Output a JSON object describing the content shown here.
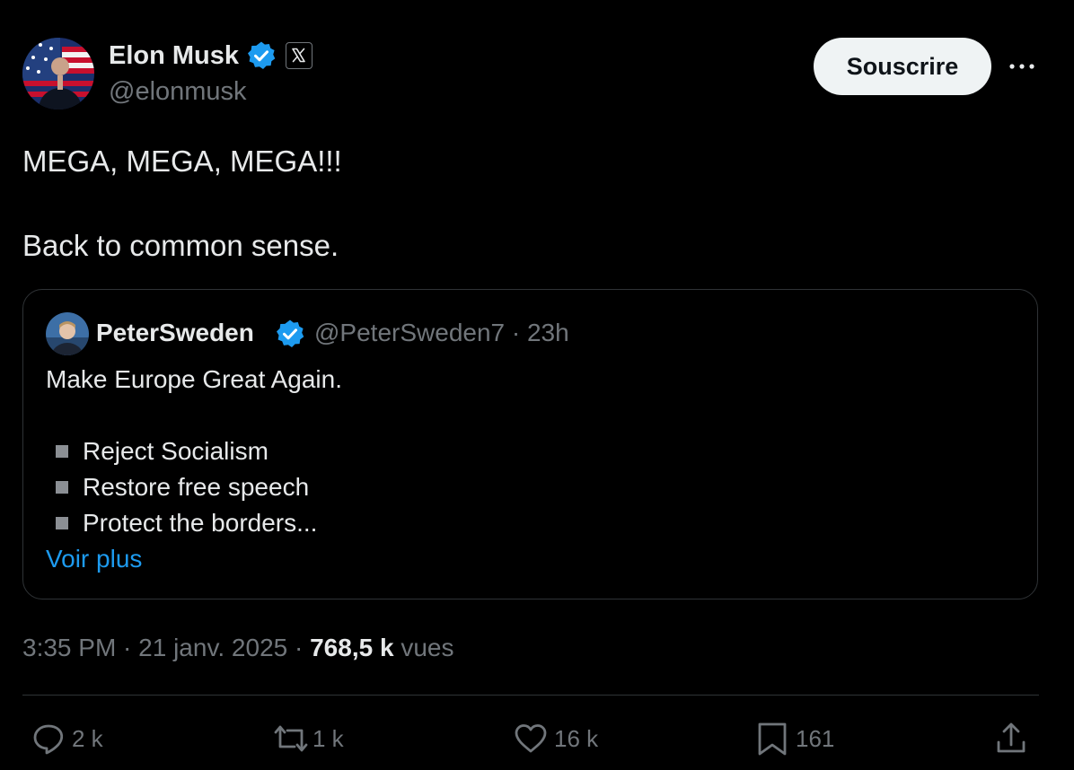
{
  "tweet": {
    "author": {
      "name": "Elon Musk",
      "handle": "@elonmusk",
      "avatar_icon": "avatar-photo-flag-background",
      "verified_icon": "verified-badge-icon",
      "affiliation_icon": "x-logo-icon"
    },
    "subscribe_label": "Souscrire",
    "more_icon": "more-dots-icon",
    "text_lines": [
      "MEGA, MEGA, MEGA!!!",
      "Back to common sense."
    ],
    "quote": {
      "name": "PeterSweden",
      "handle_time": "@PeterSweden7 · 23h",
      "text": "Make Europe Great Again.",
      "bullets": [
        "Reject Socialism",
        "Restore free speech",
        "Protect the borders..."
      ],
      "see_more": "Voir plus"
    },
    "meta": {
      "time_date": "3:35 PM · 21 janv. 2025 · ",
      "views_count": "768,5 k",
      "views_label": "vues"
    },
    "actions": {
      "replies": "2 k",
      "reposts": "1 k",
      "likes": "16 k",
      "bookmarks": "161"
    }
  },
  "colors": {
    "background": "#000000",
    "text_primary": "#e7e9ea",
    "text_secondary": "#71767b",
    "accent_blue": "#1d9bf0",
    "border": "#2f3336",
    "button_bg": "#eff3f4"
  }
}
